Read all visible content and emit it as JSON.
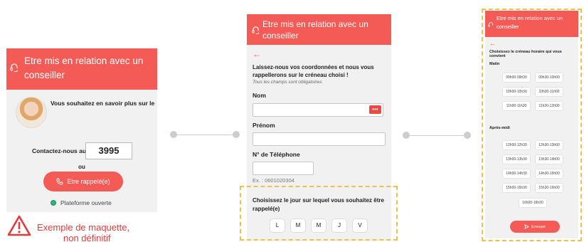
{
  "colors": {
    "accent": "#f45b57",
    "highlight_border": "#efc04a",
    "status_open": "#2fb47b",
    "warning_text": "#e23b3b"
  },
  "panel1": {
    "header_title": "Etre mis en relation avec un conseiller",
    "intro": "Vous souhaitez en savoir plus sur le",
    "contact_label": "Contactez-nous au",
    "phone_number": "3995",
    "or_label": "ou",
    "callback_button": "Etre rappelé(e)",
    "status_text": "Plateforme ouverte",
    "icons": {
      "header": "headset-icon",
      "callback": "phone-icon",
      "status": "status-dot-icon"
    }
  },
  "warning": {
    "line1": "Exemple de maquette,",
    "line2": "non définitif",
    "icon": "warning-triangle-icon"
  },
  "panel2": {
    "header_title": "Etre mis en relation avec un conseiller",
    "back_icon": "←",
    "lead_text": "Laissez-nous vos coordonnées et nous vous rappellerons sur le créneau choisi !",
    "required_note": "Tous les champs sont obligatoires",
    "fields": {
      "nom_label": "Nom",
      "nom_value": "",
      "prenom_label": "Prénom",
      "prenom_value": "",
      "tel_label": "N° de Téléphone",
      "tel_value": "",
      "tel_hint": "Ex. : 0601020304",
      "autofill_icon": "•••"
    },
    "day_question": "Choisissez le jour sur lequel vous souhaitez être rappelé(e)",
    "days": [
      "L",
      "M",
      "M",
      "J",
      "V"
    ]
  },
  "panel3": {
    "header_title": "Etre mis en relation avec un conseiller",
    "back_icon": "←",
    "heading": "Choisissez le créneau horaire qui vous convient",
    "morning_label": "Matin",
    "morning_slots": [
      "09h00-09h30",
      "09h30-10h00",
      "10h00-10h30",
      "10h30-11h00",
      "11h00-11h30",
      "11h30-12h00"
    ],
    "afternoon_label": "Après-midi",
    "afternoon_slots": [
      "12h00-12h30",
      "12h30-13h00",
      "13h00-13h30",
      "13h30-14h00",
      "14h00-14h30",
      "14h30-15h00",
      "15h00-15h30",
      "15h30-16h00",
      "16h00-16h30"
    ],
    "send_button": "Envoyer",
    "send_icon": "send-icon"
  }
}
